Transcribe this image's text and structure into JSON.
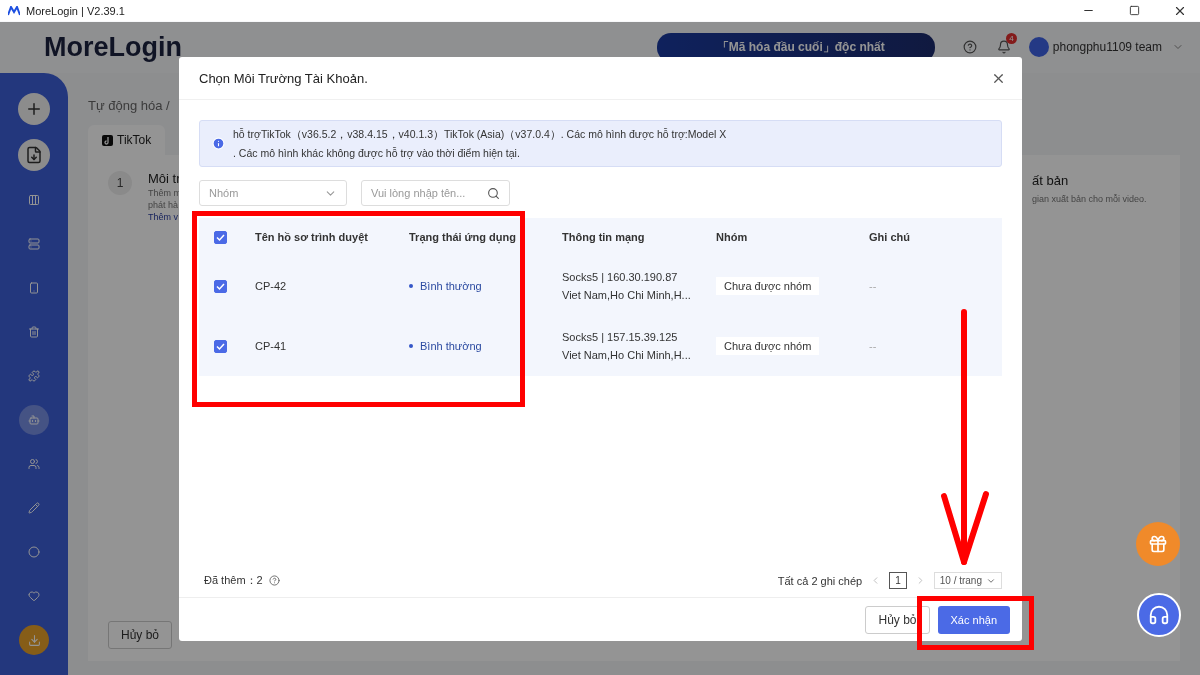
{
  "window": {
    "title": "MoreLogin | V2.39.1"
  },
  "header": {
    "logo": "MoreLogin",
    "banner": "「Mã hóa đầu cuối」độc nhất",
    "notifications": "4",
    "user": "phongphu1109 team"
  },
  "sidebar": {
    "items": [
      {
        "selected": false
      },
      {
        "selected": false
      },
      {
        "selected": false
      },
      {
        "selected": false
      },
      {
        "selected": false
      },
      {
        "selected": false
      },
      {
        "selected": false
      },
      {
        "selected": true
      },
      {
        "selected": false
      },
      {
        "selected": false
      },
      {
        "selected": false
      },
      {
        "selected": false
      }
    ]
  },
  "page": {
    "breadcrumb": "Tự động hóa /",
    "tabs": [
      {
        "label": "TikTok",
        "selected": true
      }
    ],
    "step_number": "1",
    "step_title": "Môi tr",
    "step_lines": [
      "Thêm m",
      "phát hà"
    ],
    "step_link": "Thêm v",
    "right_title": "ất bản",
    "right_text": "gian xuất bản cho mỗi video.",
    "cancel": "Hủy bỏ"
  },
  "dialog": {
    "title": "Chọn Môi Trường Tài Khoản.",
    "notice": [
      "hỗ trợTikTok（v36.5.2，v38.4.15，v40.1.3）TikTok (Asia)（v37.0.4）. Các mô hình được hỗ trợ:Model X",
      ". Các mô hình khác không được hỗ trợ vào thời điểm hiện tại."
    ],
    "group_placeholder": "Nhóm",
    "search_placeholder": "Vui lòng nhập tên...",
    "select_all": true,
    "columns": [
      "Tên hồ sơ trình duyệt",
      "Trạng thái ứng dụng",
      "Thông tin mạng",
      "Nhóm",
      "Ghi chú"
    ],
    "rows": [
      {
        "checked": true,
        "name": "CP-42",
        "status": "Bình thường",
        "network": [
          "Socks5 | 160.30.190.87",
          "Viet Nam,Ho Chi Minh,H..."
        ],
        "group": "Chưa được nhóm",
        "note": "--"
      },
      {
        "checked": true,
        "name": "CP-41",
        "status": "Bình thường",
        "network": [
          "Socks5 | 157.15.39.125",
          "Viet Nam,Ho Chi Minh,H..."
        ],
        "group": "Chưa được nhóm",
        "note": "--"
      }
    ],
    "added": "Đã thêm：2",
    "total": "Tất cả 2 ghi chép",
    "pages": [
      {
        "label": "1",
        "selected": true
      }
    ],
    "page_size": "10 / trang",
    "buttons": {
      "cancel": "Hủy bỏ",
      "confirm": "Xác nhận"
    }
  },
  "annotations": [
    {
      "kind": "frame"
    },
    {
      "kind": "frame"
    },
    {
      "kind": "arrow"
    }
  ]
}
